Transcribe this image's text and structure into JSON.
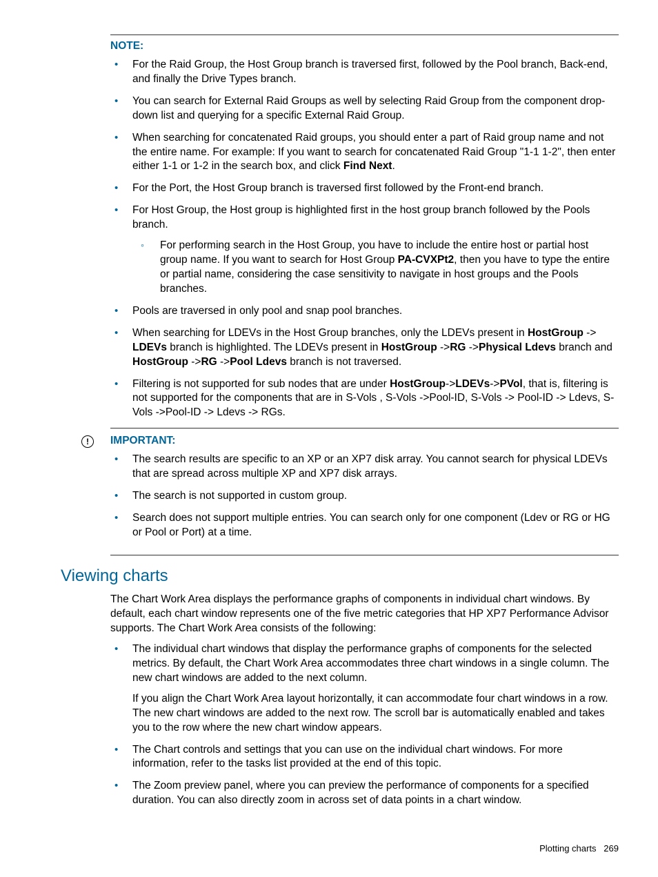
{
  "noteLabel": "NOTE:",
  "noteItems": [
    "For the Raid Group, the Host Group branch is traversed first, followed by the Pool branch, Back-end, and finally the Drive Types branch.",
    "You can search for External Raid Groups as well by selecting Raid Group from the component drop-down list and querying for a specific External Raid Group."
  ],
  "noteItem3": {
    "pre": "When searching for concatenated Raid groups, you should enter a part of Raid group name and not the entire name. For example: If you want to search for concatenated Raid Group \"1-1  1-2\", then enter either  1-1 or  1-2 in the search box, and click ",
    "bold": "Find Next",
    "post": "."
  },
  "noteItem4": "For the Port, the Host Group branch is traversed first followed by the Front-end branch.",
  "noteItem5": "For Host Group, the Host group is highlighted first in the host group branch followed by the Pools branch.",
  "noteItem5sub": {
    "pre": "For performing search in the Host Group, you have to include the entire host or partial host group name. If you want to search for Host Group ",
    "bold": "PA-CVXPt2",
    "post": ", then you have to type the entire or partial name, considering the case sensitivity to navigate in host groups and the Pools branches."
  },
  "noteItem6": "Pools are traversed in only pool and snap pool branches.",
  "noteItem7": {
    "t1": "When searching for LDEVs in the Host Group branches, only the LDEVs present in ",
    "b1": "HostGroup",
    "t2": " -> ",
    "b2": "LDEVs",
    "t3": " branch is highlighted. The LDEVs present in ",
    "b3": "HostGroup",
    "t4": " ->",
    "b4": "RG",
    "t5": " ->",
    "b5": "Physical Ldevs",
    "t6": " branch and ",
    "b6": "HostGroup",
    "t7": " ->",
    "b7": "RG",
    "t8": " ->",
    "b8": "Pool Ldevs",
    "t9": " branch is not traversed."
  },
  "noteItem8": {
    "t1": "Filtering is not supported for sub nodes that are under ",
    "b1": "HostGroup",
    "t2": "->",
    "b2": "LDEVs",
    "t3": "->",
    "b3": "PVol",
    "t4": ", that is, filtering is not supported for the components that are in S-Vols , S-Vols ->Pool-ID, S-Vols -> Pool-ID -> Ldevs, S-Vols ->Pool-ID -> Ldevs -> RGs."
  },
  "importantLabel": "IMPORTANT:",
  "importantItems": [
    "The search results are specific to an XP or an XP7 disk array. You cannot search for physical LDEVs that are spread across multiple XP and XP7 disk arrays.",
    "The search is not supported in custom group.",
    "Search does not support multiple entries. You can search only for one component (Ldev or RG or HG or Pool or Port) at a time."
  ],
  "heading": "Viewing charts",
  "intro": "The Chart Work Area displays the performance graphs of components in individual chart windows. By default, each chart window represents one of the five metric categories that HP XP7 Performance Advisor supports. The Chart Work Area consists of the following:",
  "vcItem1a": "The individual chart windows that display the performance graphs of components for the selected metrics. By default, the Chart Work Area accommodates three chart windows in a single column. The new chart windows are added to the next column.",
  "vcItem1b": "If you align the Chart Work Area layout horizontally, it can accommodate four chart windows in a row. The new chart windows are added to the next row. The scroll bar is automatically enabled and takes you to the row where the new chart window appears.",
  "vcItem2": "The Chart controls and settings that you can use on the individual chart windows. For more information, refer to the tasks list provided at the end of this topic.",
  "vcItem3": "The Zoom preview panel, where you can preview the performance of components for a specified duration. You can also directly zoom in across set of data points in a chart window.",
  "footerText": "Plotting charts",
  "footerPage": "269"
}
